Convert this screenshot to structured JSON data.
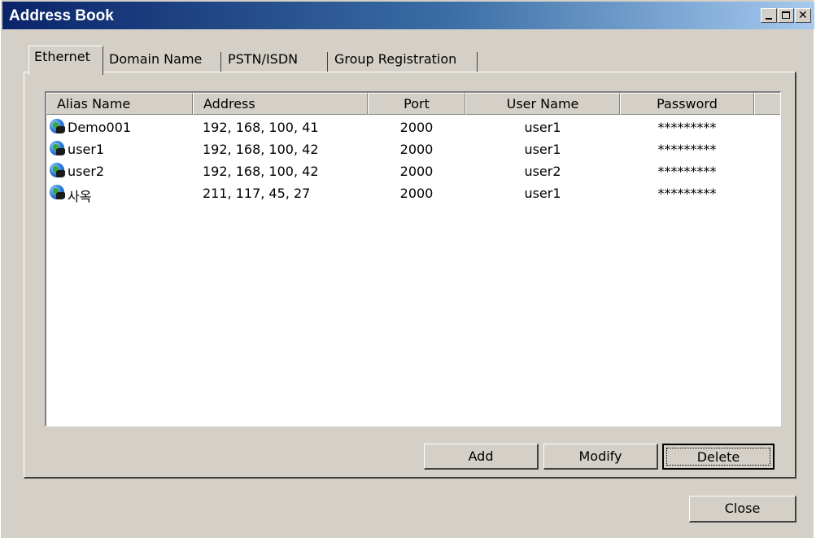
{
  "window": {
    "title": "Address Book"
  },
  "tabs": [
    {
      "label": "Ethernet"
    },
    {
      "label": "Domain Name"
    },
    {
      "label": "PSTN/ISDN"
    },
    {
      "label": "Group Registration"
    }
  ],
  "list": {
    "columns": [
      "Alias Name",
      "Address",
      "Port",
      "User Name",
      "Password"
    ],
    "rows": [
      {
        "alias": "Demo001",
        "address": "192, 168, 100, 41",
        "port": "2000",
        "user": "user1",
        "password": "*********",
        "icon": "globe-icon"
      },
      {
        "alias": "user1",
        "address": "192, 168, 100, 42",
        "port": "2000",
        "user": "user1",
        "password": "*********",
        "icon": "globe-icon"
      },
      {
        "alias": "user2",
        "address": "192, 168, 100, 42",
        "port": "2000",
        "user": "user2",
        "password": "*********",
        "icon": "globe-icon"
      },
      {
        "alias": "사옥",
        "address": "211, 117, 45, 27",
        "port": "2000",
        "user": "user1",
        "password": "*********",
        "icon": "globe-icon"
      }
    ]
  },
  "buttons": {
    "add": "Add",
    "modify": "Modify",
    "delete": "Delete",
    "close": "Close"
  }
}
